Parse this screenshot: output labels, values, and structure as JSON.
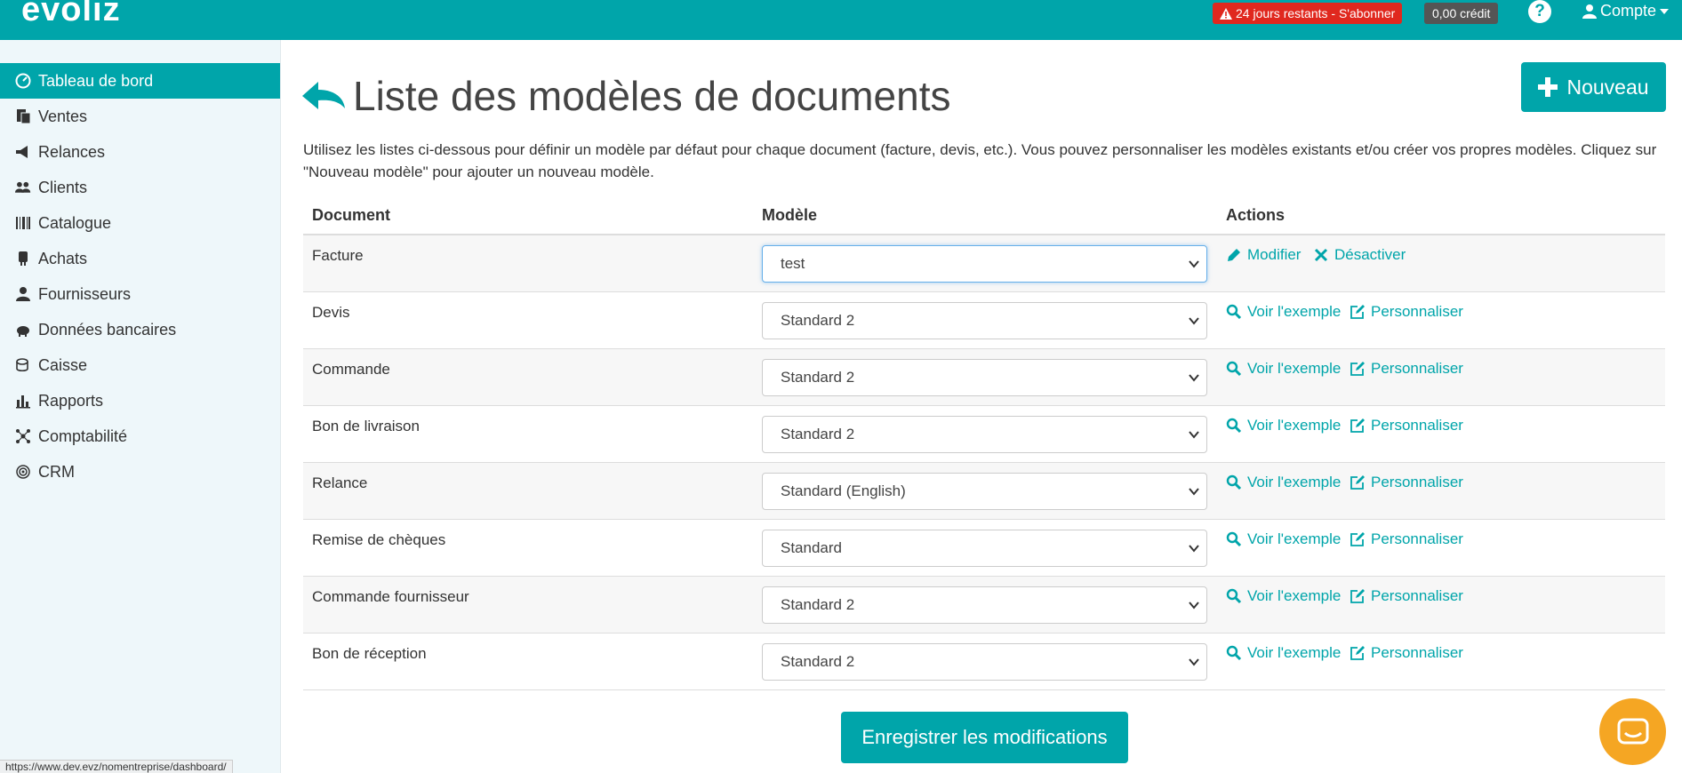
{
  "topbar": {
    "logo": "evoliz",
    "trial_text": "24 jours restants - S'abonner",
    "credit_text": "0,00 crédit",
    "account_label": "Compte",
    "accent_color": "#00a5aa"
  },
  "sidebar": {
    "items": [
      {
        "label": "Tableau de bord",
        "icon": "dashboard-icon",
        "active": true
      },
      {
        "label": "Ventes",
        "icon": "sales-icon"
      },
      {
        "label": "Relances",
        "icon": "megaphone-icon"
      },
      {
        "label": "Clients",
        "icon": "users-icon"
      },
      {
        "label": "Catalogue",
        "icon": "barcode-icon"
      },
      {
        "label": "Achats",
        "icon": "purchase-icon"
      },
      {
        "label": "Fournisseurs",
        "icon": "user-icon"
      },
      {
        "label": "Données bancaires",
        "icon": "piggy-bank-icon"
      },
      {
        "label": "Caisse",
        "icon": "coins-icon"
      },
      {
        "label": "Rapports",
        "icon": "bar-chart-icon"
      },
      {
        "label": "Comptabilité",
        "icon": "network-icon"
      },
      {
        "label": "CRM",
        "icon": "target-icon"
      }
    ]
  },
  "main": {
    "title": "Liste des modèles de documents",
    "new_button": "Nouveau",
    "intro": "Utilisez les listes ci-dessous pour définir un modèle par défaut pour chaque document (facture, devis, etc.). Vous pouvez personnaliser les modèles existants et/ou créer vos propres modèles. Cliquez sur \"Nouveau modèle\" pour ajouter un nouveau modèle.",
    "table": {
      "headers": [
        "Document",
        "Modèle",
        "Actions"
      ],
      "rows": [
        {
          "document": "Facture",
          "model": "test",
          "actions": [
            "Modifier",
            "Désactiver"
          ]
        },
        {
          "document": "Devis",
          "model": "Standard 2",
          "actions": [
            "Voir l'exemple",
            "Personnaliser"
          ]
        },
        {
          "document": "Commande",
          "model": "Standard 2",
          "actions": [
            "Voir l'exemple",
            "Personnaliser"
          ]
        },
        {
          "document": "Bon de livraison",
          "model": "Standard 2",
          "actions": [
            "Voir l'exemple",
            "Personnaliser"
          ]
        },
        {
          "document": "Relance",
          "model": "Standard (English)",
          "actions": [
            "Voir l'exemple",
            "Personnaliser"
          ]
        },
        {
          "document": "Remise de chèques",
          "model": "Standard",
          "actions": [
            "Voir l'exemple",
            "Personnaliser"
          ]
        },
        {
          "document": "Commande fournisseur",
          "model": "Standard 2",
          "actions": [
            "Voir l'exemple",
            "Personnaliser"
          ]
        },
        {
          "document": "Bon de réception",
          "model": "Standard 2",
          "actions": [
            "Voir l'exemple",
            "Personnaliser"
          ]
        }
      ]
    },
    "save_button": "Enregistrer les modifications"
  },
  "status_bar": {
    "url": "https://www.dev.evz/nomentreprise/dashboard/"
  }
}
